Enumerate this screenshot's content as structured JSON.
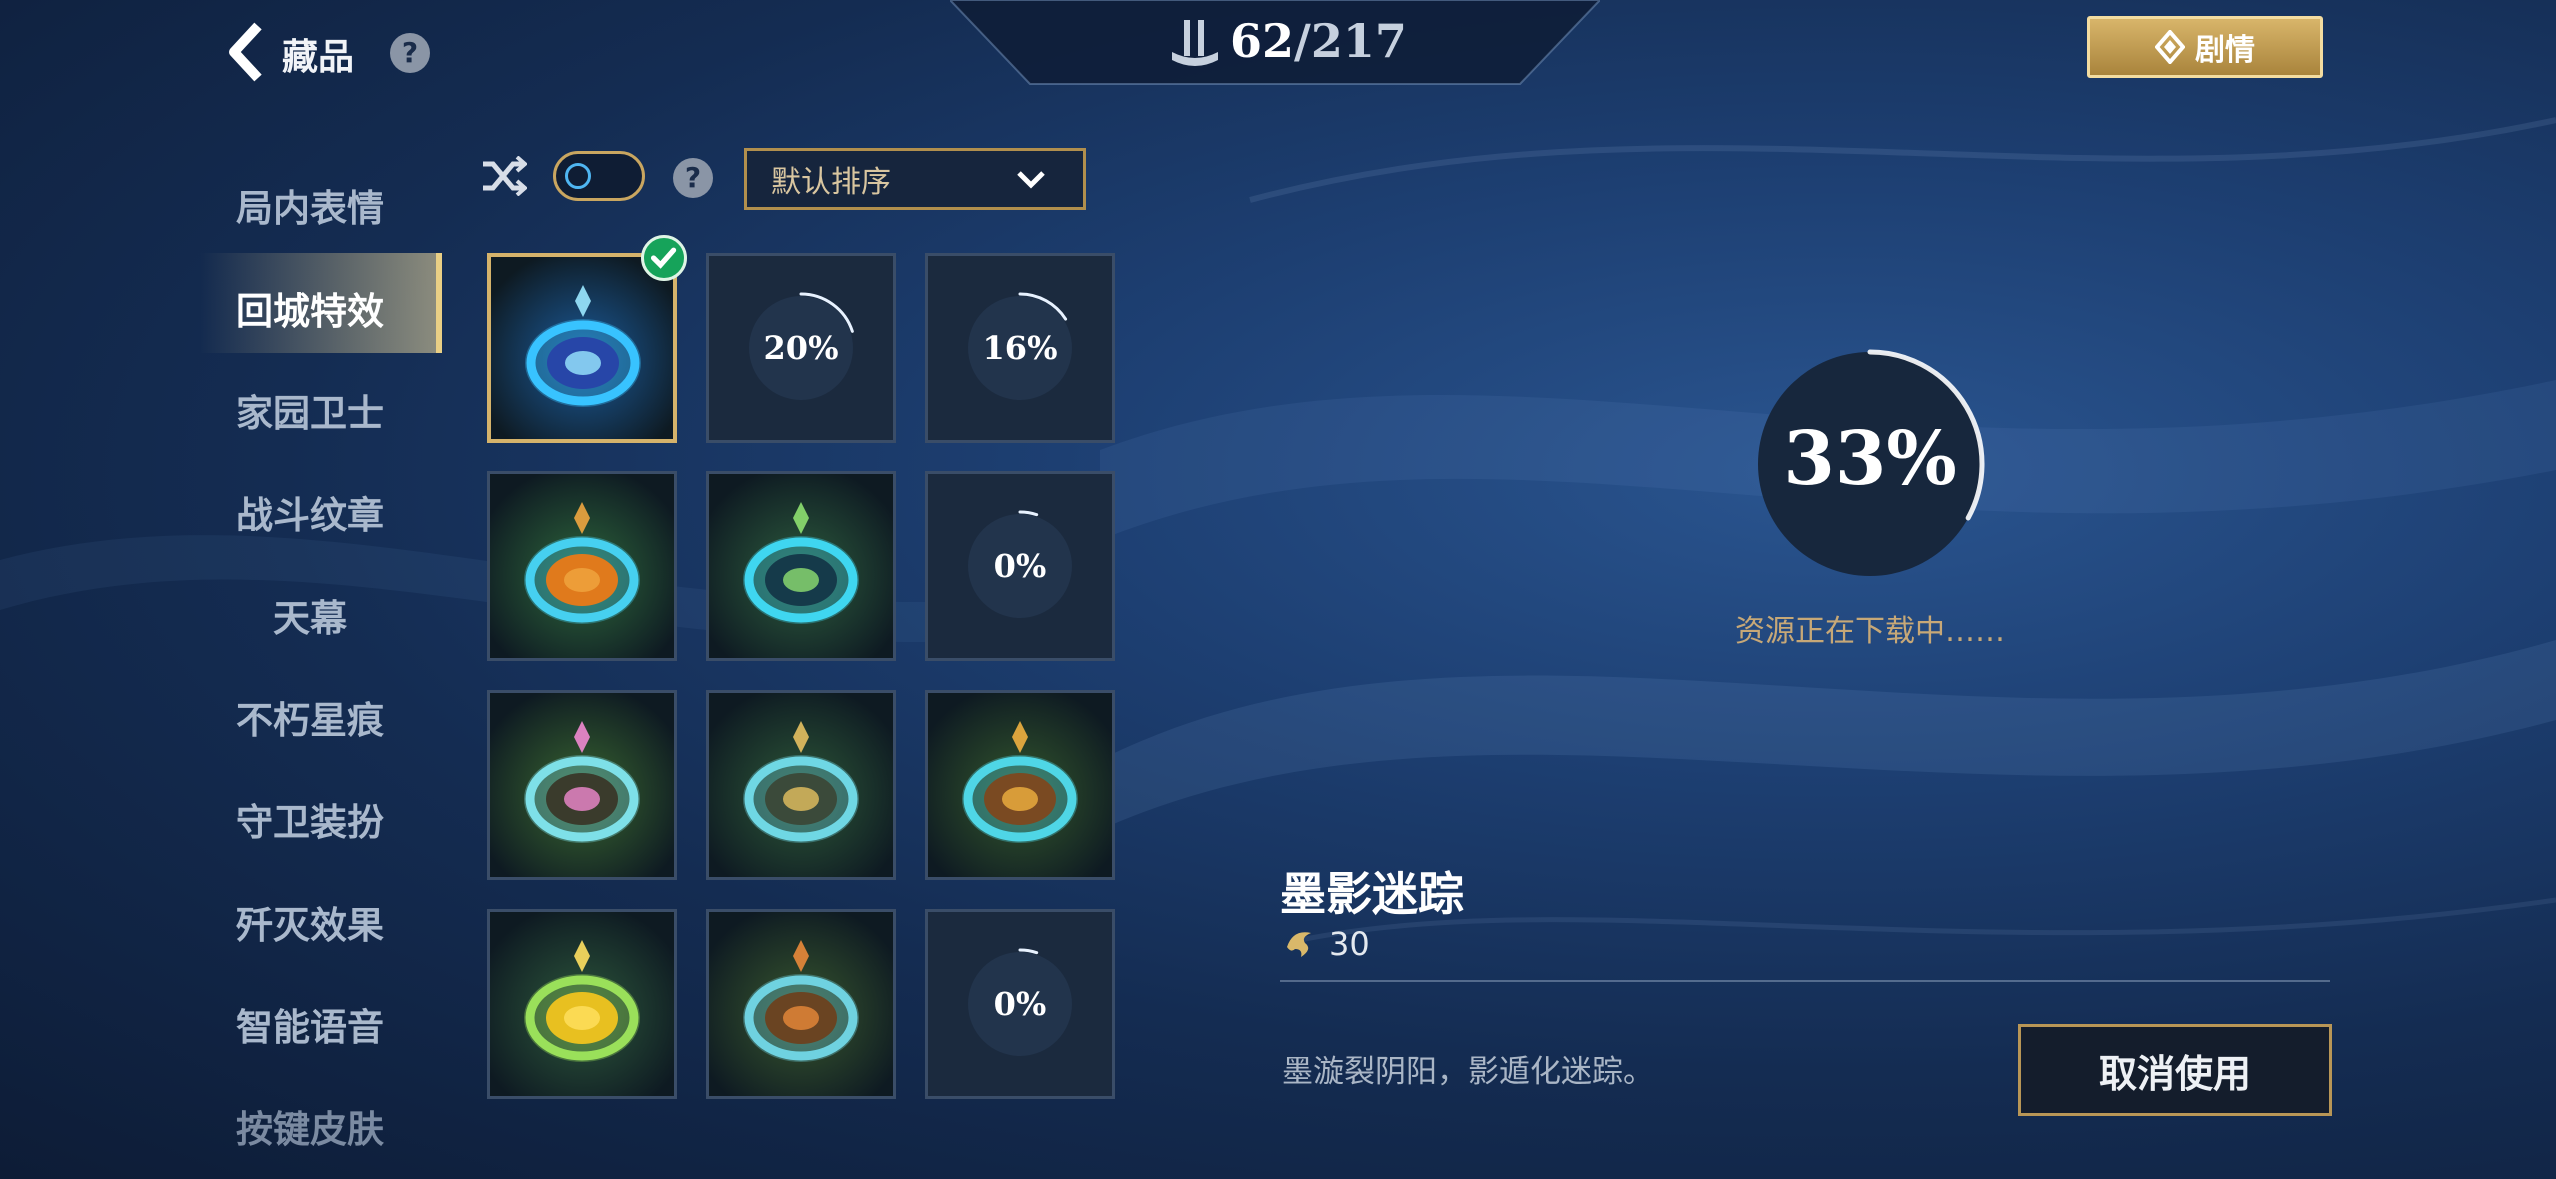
{
  "header": {
    "title": "藏品",
    "help_icon": "question-icon",
    "collection_current": "62",
    "collection_separator": "/",
    "collection_total": "217",
    "story_button_label": "剧情"
  },
  "sidebar": {
    "items": [
      {
        "label": "局内表情"
      },
      {
        "label": "回城特效",
        "active": true
      },
      {
        "label": "家园卫士"
      },
      {
        "label": "战斗纹章"
      },
      {
        "label": "天幕"
      },
      {
        "label": "不朽星痕"
      },
      {
        "label": "守卫装扮"
      },
      {
        "label": "歼灭效果"
      },
      {
        "label": "智能语音"
      },
      {
        "label": "按键皮肤"
      }
    ]
  },
  "toolbar": {
    "shuffle_icon": "shuffle-icon",
    "toggle_on": false,
    "sort_selected": "默认排序"
  },
  "grid": {
    "tiles": [
      {
        "kind": "image",
        "selected": true,
        "theme": "blue-spiral"
      },
      {
        "kind": "download",
        "percent_label": "20%",
        "progress": 0.2
      },
      {
        "kind": "download",
        "percent_label": "16%",
        "progress": 0.16
      },
      {
        "kind": "image",
        "theme": "orange-mask"
      },
      {
        "kind": "image",
        "theme": "green-leaf"
      },
      {
        "kind": "download",
        "percent_label": "0%",
        "progress": 0.0
      },
      {
        "kind": "image",
        "theme": "pink-flower"
      },
      {
        "kind": "image",
        "theme": "gold-trophy"
      },
      {
        "kind": "image",
        "theme": "bronze-flame"
      },
      {
        "kind": "image",
        "theme": "yellow-ring"
      },
      {
        "kind": "image",
        "theme": "bronze-flag"
      },
      {
        "kind": "download",
        "percent_label": "0%",
        "progress": 0.0
      }
    ]
  },
  "detail": {
    "download_percent": "33%",
    "download_progress": 0.33,
    "download_status": "资源正在下载中……",
    "item_name": "墨影迷踪",
    "price": "30",
    "description": "墨漩裂阴阳，影遁化迷踪。",
    "cancel_button_label": "取消使用"
  },
  "colors": {
    "accent_gold": "#d5b36b",
    "active_check": "#16a35a"
  }
}
